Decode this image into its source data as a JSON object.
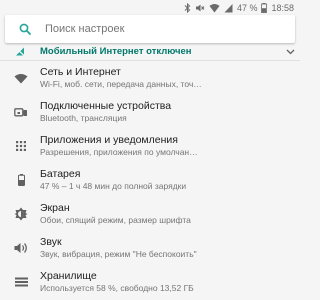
{
  "status_bar": {
    "battery_percent": "47 %",
    "time": "18:58",
    "icons": [
      "bluetooth-icon",
      "mute-icon",
      "wifi-icon",
      "signal-icon",
      "battery-icon"
    ]
  },
  "search": {
    "placeholder": "Поиск настроек",
    "icon": "search-icon"
  },
  "banner": {
    "text": "Мобильный Интернет отключен",
    "icon": "mobile-data-off-icon",
    "expand_icon": "chevron-down-icon",
    "color": "#00796b"
  },
  "settings": [
    {
      "title": "Сеть и Интернет",
      "subtitle": "Wi-Fi, моб. сети, передача данных, точ…",
      "icon": "wifi-icon"
    },
    {
      "title": "Подключенные устройства",
      "subtitle": "Bluetooth, трансляция",
      "icon": "devices-icon"
    },
    {
      "title": "Приложения и уведомления",
      "subtitle": "Разрешения, приложения по умолчан…",
      "icon": "apps-icon"
    },
    {
      "title": "Батарея",
      "subtitle": "47 % – 1 ч 48 мин до полной зарядки",
      "icon": "battery-icon"
    },
    {
      "title": "Экран",
      "subtitle": "Обои, спящий режим, размер шрифта",
      "icon": "brightness-icon"
    },
    {
      "title": "Звук",
      "subtitle": "Звук, вибрация, режим \"Не беспокоить\"",
      "icon": "volume-icon"
    },
    {
      "title": "Хранилище",
      "subtitle": "Используется 58 %, свободно 13,52 ГБ",
      "icon": "storage-icon"
    }
  ],
  "colors": {
    "accent": "#00796b",
    "search_icon": "#26a69a",
    "icon_gray": "#616161",
    "background": "#f5f5f5"
  }
}
